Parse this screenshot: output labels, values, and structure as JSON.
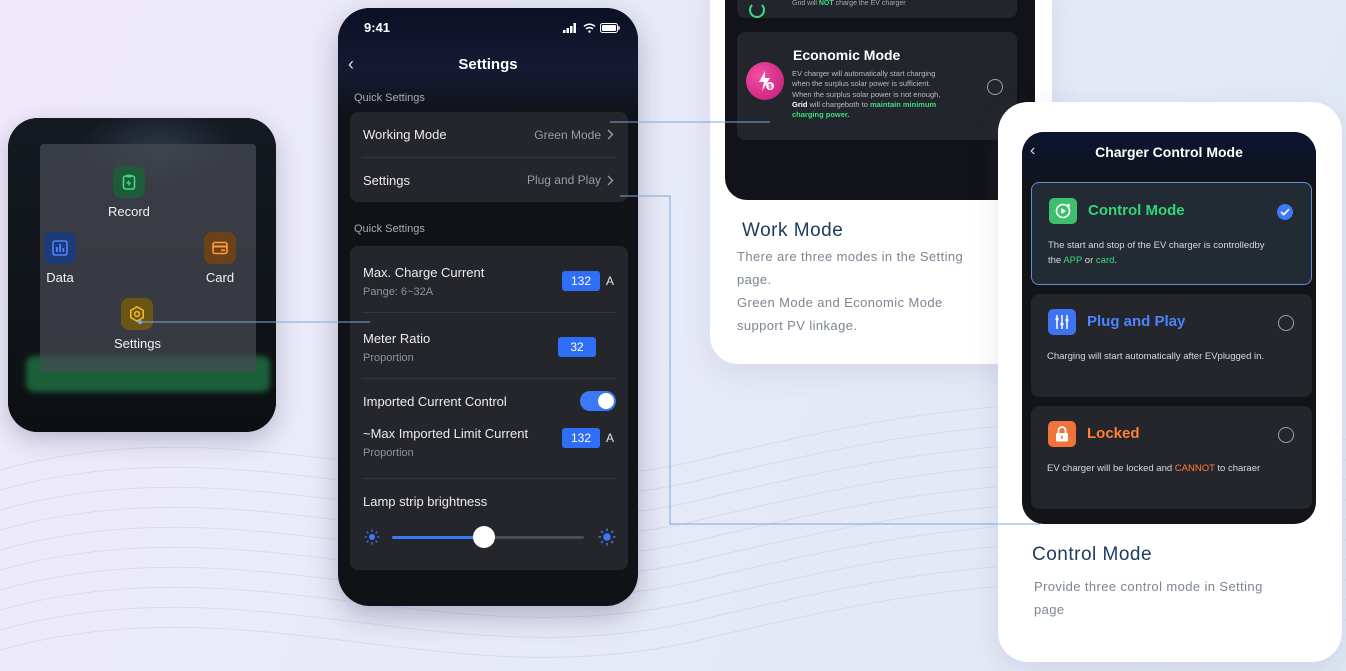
{
  "colors": {
    "accent_blue": "#2f6ef6",
    "green": "#3ddc84",
    "orange": "#ff7a30",
    "control_mode_green": "#34d47a",
    "plug_play_blue": "#4c84ff",
    "locked_orange": "#ff7e3a",
    "caption_title": "#1e3a5f",
    "caption_text": "#7c8593"
  },
  "menu": {
    "items": [
      {
        "label": "Record",
        "icon": "clipboard-icon",
        "color": "#2fbf6a"
      },
      {
        "label": "Data",
        "icon": "bar-chart-icon",
        "color": "#3b7bf6"
      },
      {
        "label": "Card",
        "icon": "card-icon",
        "color": "#f0922f"
      },
      {
        "label": "Settings",
        "icon": "hexagon-gear-icon",
        "color": "#f5b623"
      }
    ]
  },
  "settings_phone": {
    "status_time": "9:41",
    "title": "Settings",
    "section1_label": "Quick Settings",
    "working_mode": {
      "label": "Working Mode",
      "value": "Green Mode"
    },
    "settings_row": {
      "label": "Settings",
      "value": "Plug and Play"
    },
    "section2_label": "Quick Settings",
    "max_charge": {
      "label": "Max. Charge Current",
      "sub": "Pange: 6~32A",
      "value": "132",
      "unit": "A"
    },
    "meter_ratio": {
      "label": "Meter Ratio",
      "sub": "Proportion",
      "value": "32"
    },
    "imported_control": {
      "label": "Imported Current Control",
      "on": true
    },
    "max_imported": {
      "label": "~Max Imported Limit Current",
      "sub": "Proportion",
      "value": "132",
      "unit": "A"
    },
    "lamp": {
      "label": "Lamp strip brightness",
      "level": 0.48
    }
  },
  "work_mode_phone": {
    "top_text_prefix": "Grid will ",
    "top_text_strong": "NOT",
    "top_text_suffix": " charge the EV charger",
    "economic_title": "Economic Mode",
    "economic_desc_1": "EV charger will automatically start charging",
    "economic_desc_2": "when the surplus solar power is sufficient.",
    "economic_desc_3": "When the surplus solar power is not enough,",
    "economic_desc_grid": "Grid",
    "economic_desc_mid": " will chargeboth to ",
    "economic_desc_green1": "maintain minimum",
    "economic_desc_green2": "charging power."
  },
  "work_mode_caption": {
    "title": "Work Mode",
    "line1": "There are three modes in the Setting",
    "line2": "page.",
    "line3": "Green Mode and Economic Mode",
    "line4": "support PV linkage."
  },
  "control_phone": {
    "title": "Charger Control Mode",
    "options": [
      {
        "name": "Control Mode",
        "desc_prefix": "The start and stop of the EV charger is controlledby",
        "desc_the": "the ",
        "desc_app": "APP",
        "desc_or": " or ",
        "desc_card": "card",
        "desc_end": ".",
        "selected": true
      },
      {
        "name": "Plug and Play",
        "desc": "Charging will start automatically after EVplugged in.",
        "selected": false
      },
      {
        "name": "Locked",
        "desc_prefix": "EV charger will be locked and ",
        "desc_strong": "CANNOT",
        "desc_suffix": " to charaer",
        "selected": false
      }
    ]
  },
  "control_caption": {
    "title": "Control Mode",
    "line1": "Provide three control mode in Setting",
    "line2": "page"
  }
}
